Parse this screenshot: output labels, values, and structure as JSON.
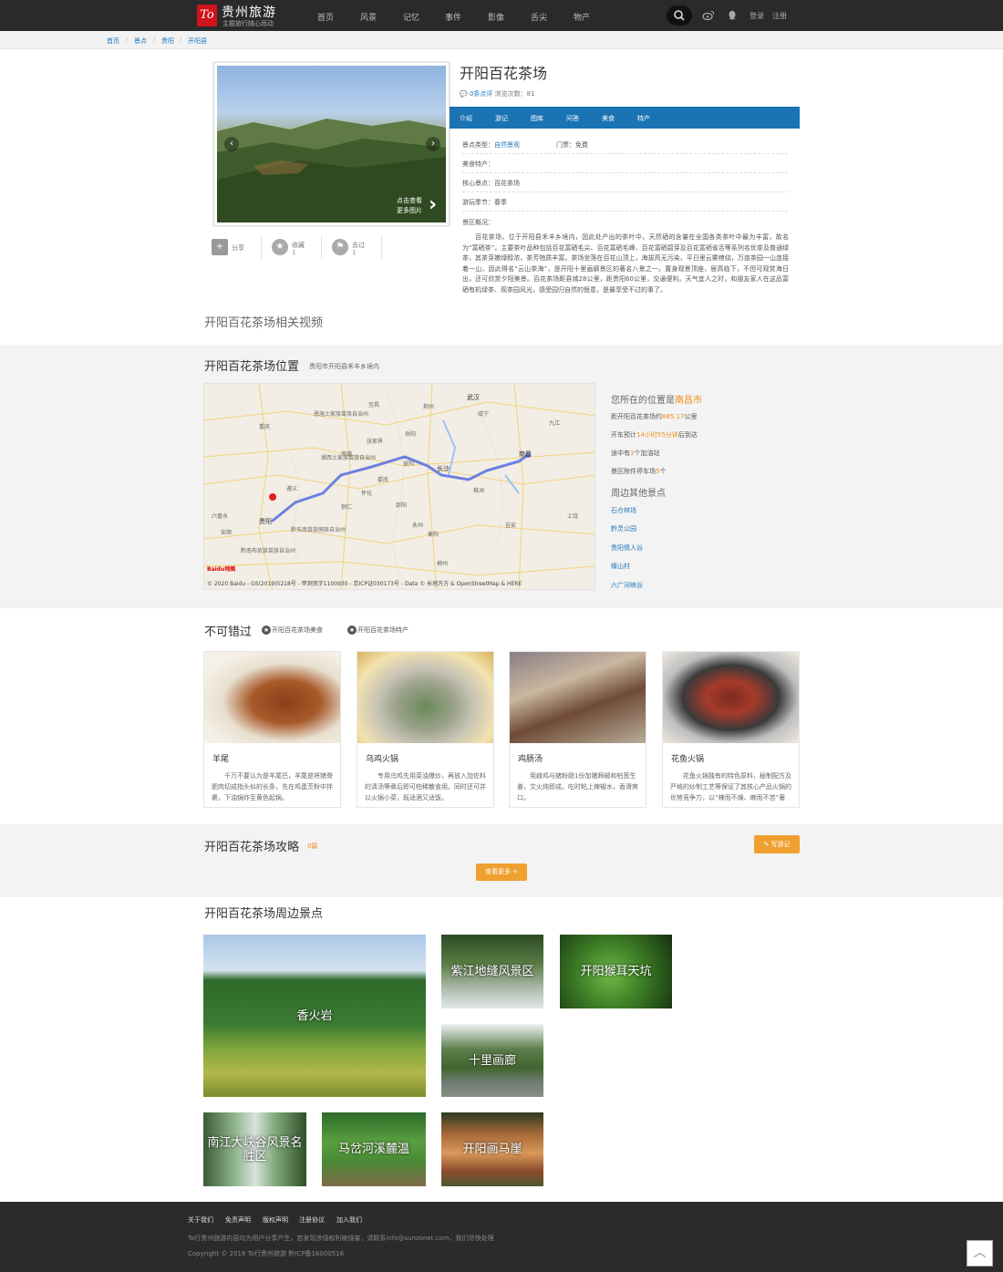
{
  "header": {
    "logo_mark": "To",
    "site_name": "贵州旅游",
    "site_tagline": "主题旅行随心而动",
    "nav": [
      "首页",
      "风景",
      "记忆",
      "事件",
      "影像",
      "舌尖",
      "物产"
    ],
    "login": "登录",
    "register": "注册"
  },
  "breadcrumb": [
    "首页",
    "景点",
    "贵阳",
    "开阳县"
  ],
  "gallery": {
    "more_line1": "点击查看",
    "more_line2": "更多图片"
  },
  "actions": {
    "share": "分享",
    "favorite": "收藏",
    "favorite_count": "1",
    "visited": "去过",
    "visited_count": "1"
  },
  "spot": {
    "title": "开阳百花茶场",
    "reviews": "0条点评",
    "views": "浏览次数：81",
    "tabs": [
      "介绍",
      "游记",
      "图库",
      "问答",
      "美食",
      "特产"
    ],
    "type_label": "景点类型：",
    "type_value": "自然景观",
    "ticket": "门票：免费",
    "food_label": "美食特产：",
    "core_label": "核心景点：",
    "core_value": "百花茶场",
    "season_label": "游玩季节：",
    "season_value": "春季",
    "intro_label": "景区概况：",
    "intro": "百花茶场，位于开阳县禾丰乡境内，因此处产出的茶叶中，天然硒的含量在全国各类茶叶中最为丰富，故名为“富硒茶”。主要茶叶品种包括百花富硒毛尖、百花富硒毛峰、百花富硒碧芽及百花富硒雀舌等系列名优茶及普通绿茶，其茶芽嫩绿醇浓，茶芳物质丰富。茶场坐落在百花山顶上，海拔高无污染，平日里云雾缭绕，万亩茶园一山连接着一山，因此得名“云山茶海”，是开阳十里画廊景区的著名八景之一。置身观景顶座，居高临下，不但可观赏海日出，还可欣赏夕阳美景。百花茶场距县城28公里，距贵阳60公里，交通便利。天气宜人之时，和朋友家人在这品富硒有机绿茶、观茶园风光，感受园归自然的惬意，是最享受不过的事了。",
    "video_title": "开阳百花茶场相关视频"
  },
  "map_section": {
    "title": "开阳百花茶场位置",
    "address": "贵阳市开阳县禾丰乡境内",
    "copyright": "© 2020 Baidu - GS(2019)5218号 - 甲测资字1100930 - 京ICP证030173号 - Data © 长地万方 & OpenStreetMap & HERE",
    "labels": [
      "武汉",
      "长沙",
      "南昌",
      "贵阳",
      "重庆",
      "恩施土家族苗族自治州",
      "湘西土家族苗族自治州",
      "黔东南苗族侗族自治州",
      "黔南布依族苗族自治州",
      "张家界",
      "岳阳",
      "怀化",
      "邵阳",
      "娄底",
      "常德",
      "益阳",
      "株洲",
      "九江",
      "上饶",
      "咸宁",
      "安顺",
      "六盘水",
      "遵义",
      "铜仁",
      "宜昌",
      "荆州",
      "衡阳",
      "永州",
      "郴州",
      "吉安"
    ],
    "my_location_prefix": "您所在的位置是",
    "my_location": "南昌市",
    "distance_prefix": "距开阳百花茶场约",
    "distance": "885.17",
    "distance_unit": "公里",
    "drive_prefix": "开车预计",
    "drive": "14小时55分钟",
    "drive_suffix": "后到达",
    "gas_prefix": "途中有",
    "gas": "3",
    "gas_suffix": "个加油站",
    "parking_prefix": "景区附件停车场",
    "parking": "5",
    "parking_suffix": "个",
    "nearby_title": "周边其他景点",
    "nearby_links": [
      "石仓林场",
      "黔灵公园",
      "贵阳情人谷",
      "蝶山村",
      "六广河峡谷"
    ]
  },
  "must_see": {
    "title": "不可错过",
    "tab_food": "开阳百花茶场美食",
    "tab_product": "开阳百花茶场特产",
    "items": [
      {
        "name": "羊尾",
        "desc": "千万不要认为是羊尾巴，羊尾是将猪脊肥肉切成指头似的长条，先在鸡蛋芡粉中拌裹，下油锅炸至黄色起锅。"
      },
      {
        "name": "乌鸡火锅",
        "desc": "专用乌鸡先用菜油爆炒，再放入加佐料的清汤等煮后即可柏稀散食用。同时还可并以火锅小菜，既适酒又适饭。"
      },
      {
        "name": "鸡肠汤",
        "desc": "用雌鸡与猪粉肠1份加猪蹄椒和柏葱生姜，文火炖即成。吃时粘上辣椒水，香滑爽口。"
      },
      {
        "name": "花鱼火锅",
        "desc": "花鱼火锅独有的特色原料，秘制配方及严格的炒制工艺等保证了其核心产品火锅的优势竞争力，以“辣而不燥、麻而不苦”著称。"
      }
    ]
  },
  "guide": {
    "title": "开阳百花茶场攻略",
    "count": "0篇",
    "write": "写游记",
    "more": "查看更多"
  },
  "nearby": {
    "title": "开阳百花茶场周边景点",
    "tiles": [
      "香火岩",
      "紫江地缝风景区",
      "开阳猴耳天坑",
      "十里画廊",
      "南江大峡谷风景名胜区",
      "马岔河溪麓温",
      "开阳画马崖"
    ]
  },
  "footer": {
    "links": [
      "关于我们",
      "免责声明",
      "版权声明",
      "注册协议",
      "加入我们"
    ],
    "note": "To行贵州旅游内容均为用户分享产生，若发现涉侵权利被侵害，请联系info@sunzonet.com，我们尽快处理",
    "copyright": "Copyright © 2016 To行贵州旅游 黔ICP备16000516"
  }
}
